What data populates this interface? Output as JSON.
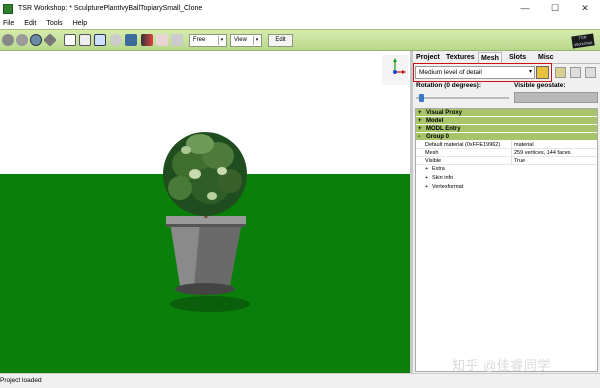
{
  "window": {
    "title": "TSR Workshop: * SculpturePlantIvyBallTopiarySmall_Clone",
    "controls": {
      "minimize": "—",
      "maximize": "☐",
      "close": "✕"
    }
  },
  "menu": [
    "File",
    "Edit",
    "Tools",
    "Help"
  ],
  "toolbar": {
    "free_label": "Free",
    "view_label": "View",
    "edit_label": "Edit",
    "logo_text": "TSR Workshop"
  },
  "panel": {
    "tabs": [
      "Project",
      "Textures",
      "Mesh",
      "Slots",
      "Misc"
    ],
    "active_tab": "Mesh",
    "lod_select": "Medium level of detail",
    "rotation_label": "Rotation (0 degrees):",
    "visible_geostate_label": "Visible geostate:",
    "rotation_value": 0,
    "sections": [
      {
        "pm": "+",
        "label": "Visual Proxy"
      },
      {
        "pm": "+",
        "label": "Model"
      },
      {
        "pm": "+",
        "label": "MODL Entry"
      },
      {
        "pm": "-",
        "label": "Group 0"
      }
    ],
    "properties": [
      {
        "key": "Default material (0xFFE19962)",
        "value": "material"
      },
      {
        "key": "Mesh",
        "value": "259 vertices, 144 faces"
      },
      {
        "key": "Visible",
        "value": "True"
      }
    ],
    "subnodes": [
      {
        "pm": "+",
        "label": "Extra"
      },
      {
        "pm": "+",
        "label": "Skin info"
      },
      {
        "pm": "+",
        "label": "Vertexformat"
      }
    ]
  },
  "colors": {
    "toolbar": "#c8e29c",
    "ground": "#0a7f0a",
    "section_header": "#a8c46a",
    "highlight": "#d01010"
  },
  "watermark": "知乎 @佳睿同学",
  "status": "Project loaded"
}
